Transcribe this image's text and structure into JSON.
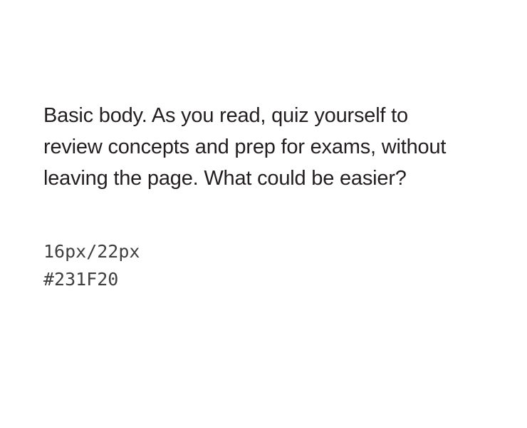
{
  "sample": {
    "text": "Basic body. As you read, quiz yourself to review concepts and prep for exams, without leaving the page. What could be easier?"
  },
  "spec": {
    "size": "16px/22px",
    "color": "#231F20"
  }
}
